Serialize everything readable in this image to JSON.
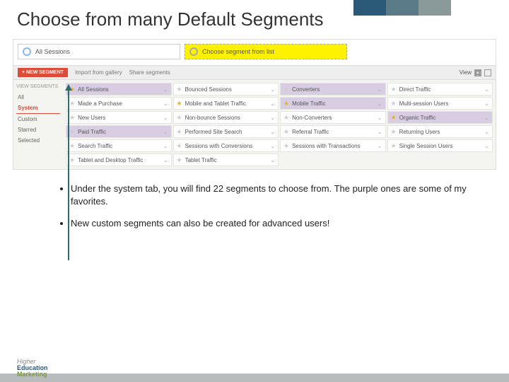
{
  "title": "Choose from many Default Segments",
  "selectors": {
    "all_sessions": "All Sessions",
    "choose_from_list": "Choose segment from list"
  },
  "toolbar": {
    "new_segment": "+ NEW SEGMENT",
    "import": "Import from gallery",
    "share": "Share segments",
    "view": "View"
  },
  "sidebar": {
    "title": "VIEW SEGMENTS",
    "items": [
      "All",
      "System",
      "Custom",
      "Starred",
      "Selected"
    ],
    "active_index": 1
  },
  "segments": [
    {
      "label": "All Sessions",
      "fav": true,
      "star": true
    },
    {
      "label": "Bounced Sessions",
      "fav": false,
      "star": false
    },
    {
      "label": "Converters",
      "fav": true,
      "star": false
    },
    {
      "label": "Direct Traffic",
      "fav": false,
      "star": false
    },
    {
      "label": "Made a Purchase",
      "fav": false,
      "star": false
    },
    {
      "label": "Mobile and Tablet Traffic",
      "fav": false,
      "star": true
    },
    {
      "label": "Mobile Traffic",
      "fav": true,
      "star": true
    },
    {
      "label": "Multi-session Users",
      "fav": false,
      "star": false
    },
    {
      "label": "New Users",
      "fav": false,
      "star": false
    },
    {
      "label": "Non-bounce Sessions",
      "fav": false,
      "star": false
    },
    {
      "label": "Non-Converters",
      "fav": false,
      "star": false
    },
    {
      "label": "Organic Traffic",
      "fav": true,
      "star": true
    },
    {
      "label": "Paid Traffic",
      "fav": true,
      "star": false
    },
    {
      "label": "Performed Site Search",
      "fav": false,
      "star": false
    },
    {
      "label": "Referral Traffic",
      "fav": false,
      "star": false
    },
    {
      "label": "Returning Users",
      "fav": false,
      "star": false
    },
    {
      "label": "Search Traffic",
      "fav": false,
      "star": false
    },
    {
      "label": "Sessions with Conversions",
      "fav": false,
      "star": false
    },
    {
      "label": "Sessions with Transactions",
      "fav": false,
      "star": false
    },
    {
      "label": "Single Session Users",
      "fav": false,
      "star": false
    },
    {
      "label": "Tablet and Desktop Traffic",
      "fav": false,
      "star": false
    },
    {
      "label": "Tablet Traffic",
      "fav": false,
      "star": false
    }
  ],
  "notes": {
    "b1": "Under the system tab, you will find 22 segments to choose from. The purple ones are some of my favorites.",
    "b2": "New custom segments can also be created for advanced users!"
  },
  "logo": {
    "l1": "Higher",
    "l2": "Education",
    "l3": "Marketing"
  }
}
